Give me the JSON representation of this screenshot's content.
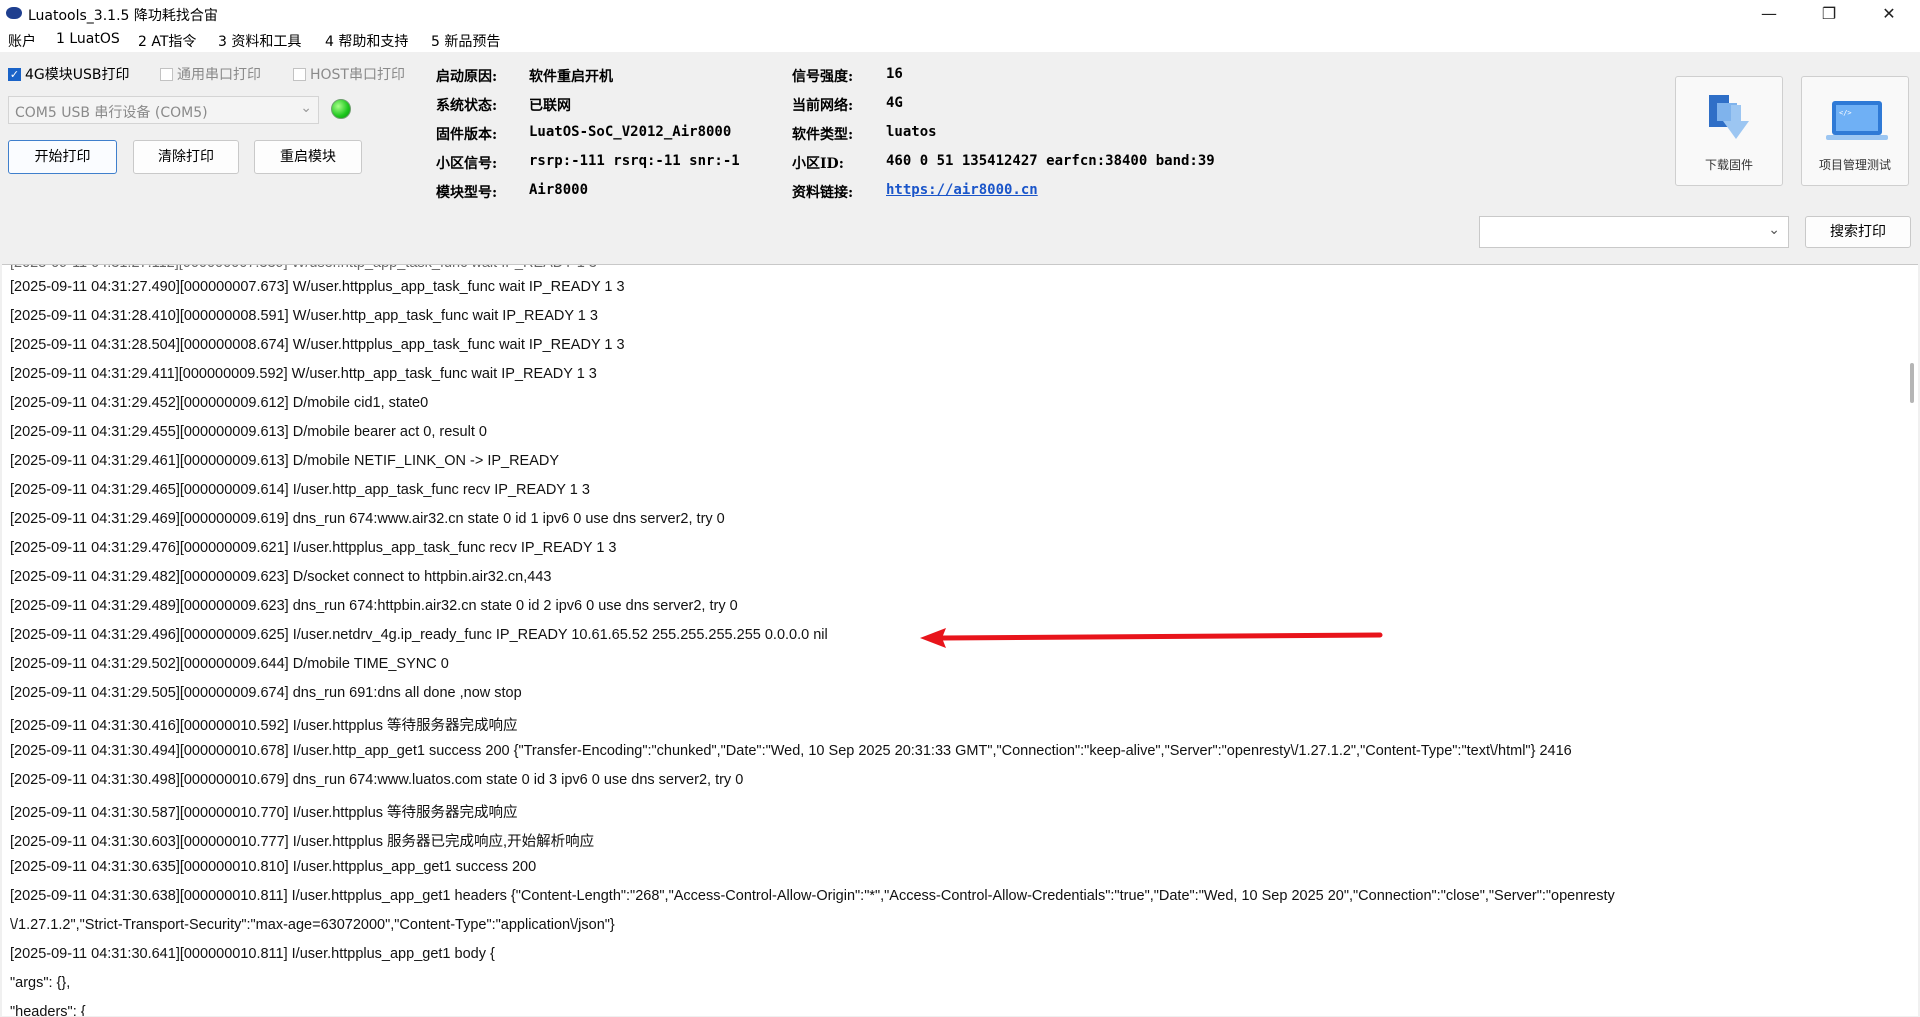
{
  "window": {
    "title": "Luatools_3.1.5 降功耗找合宙",
    "minimize": "—",
    "restore": "❐",
    "close": "✕"
  },
  "menu": [
    "账户",
    "1 LuatOS",
    "2 AT指令",
    "3 资料和工具",
    "4 帮助和支持",
    "5 新品预告"
  ],
  "options": {
    "usb_print": {
      "label": "4G模块USB打印",
      "checked": true
    },
    "serial_print": {
      "label": "通用串口打印",
      "checked": false
    },
    "host_print": {
      "label": "HOST串口打印",
      "checked": false
    }
  },
  "port_select": {
    "value": "COM5 USB 串行设备 (COM5)"
  },
  "buttons": {
    "start_print": "开始打印",
    "clear_print": "清除打印",
    "restart_module": "重启模块"
  },
  "device_info": {
    "boot_reason_label": "启动原因:",
    "boot_reason": "软件重启开机",
    "system_state_label": "系统状态:",
    "system_state": "已联网",
    "firmware_label": "固件版本:",
    "firmware": "LuatOS-SoC_V2012_Air8000",
    "cell_signal_label": "小区信号:",
    "cell_signal": "rsrp:-111 rsrq:-11 snr:-1",
    "module_model_label": "模块型号:",
    "module_model": "Air8000",
    "signal_strength_label": "信号强度:",
    "signal_strength": "16",
    "network_label": "当前网络:",
    "network": "4G",
    "software_type_label": "软件类型:",
    "software_type": "luatos",
    "cell_id_label": "小区ID:",
    "cell_id": "460 0 51 135412427 earfcn:38400 band:39",
    "docs_link_label": "资料链接:",
    "docs_link": "https://air8000.cn"
  },
  "tools": {
    "download_firmware": "下载固件",
    "project_test": "项目管理测试"
  },
  "search": {
    "value": "",
    "button": "搜索打印"
  },
  "log": [
    "[2025-09-11 04:31:27.490][000000007.673] W/user.httpplus_app_task_func wait IP_READY 1 3",
    "[2025-09-11 04:31:28.410][000000008.591] W/user.http_app_task_func wait IP_READY 1 3",
    "[2025-09-11 04:31:28.504][000000008.674] W/user.httpplus_app_task_func wait IP_READY 1 3",
    "[2025-09-11 04:31:29.411][000000009.592] W/user.http_app_task_func wait IP_READY 1 3",
    "[2025-09-11 04:31:29.452][000000009.612] D/mobile cid1, state0",
    "[2025-09-11 04:31:29.455][000000009.613] D/mobile bearer act 0, result 0",
    "[2025-09-11 04:31:29.461][000000009.613] D/mobile NETIF_LINK_ON -> IP_READY",
    "[2025-09-11 04:31:29.465][000000009.614] I/user.http_app_task_func recv IP_READY 1 3",
    "[2025-09-11 04:31:29.469][000000009.619] dns_run 674:www.air32.cn state 0 id 1 ipv6 0 use dns server2, try 0",
    "[2025-09-11 04:31:29.476][000000009.621] I/user.httpplus_app_task_func recv IP_READY 1 3",
    "[2025-09-11 04:31:29.482][000000009.623] D/socket connect to httpbin.air32.cn,443",
    "[2025-09-11 04:31:29.489][000000009.623] dns_run 674:httpbin.air32.cn state 0 id 2 ipv6 0 use dns server2, try 0",
    "[2025-09-11 04:31:29.496][000000009.625] I/user.netdrv_4g.ip_ready_func IP_READY 10.61.65.52 255.255.255.255 0.0.0.0 nil",
    "[2025-09-11 04:31:29.502][000000009.644] D/mobile TIME_SYNC 0",
    "[2025-09-11 04:31:29.505][000000009.674] dns_run 691:dns all done ,now stop",
    "[2025-09-11 04:31:30.416][000000010.592] I/user.httpplus 等待服务器完成响应",
    "[2025-09-11 04:31:30.494][000000010.678] I/user.http_app_get1 success 200 {\"Transfer-Encoding\":\"chunked\",\"Date\":\"Wed, 10 Sep 2025 20:31:33 GMT\",\"Connection\":\"keep-alive\",\"Server\":\"openresty\\/1.27.1.2\",\"Content-Type\":\"text\\/html\"} 2416",
    "[2025-09-11 04:31:30.498][000000010.679] dns_run 674:www.luatos.com state 0 id 3 ipv6 0 use dns server2, try 0",
    "[2025-09-11 04:31:30.587][000000010.770] I/user.httpplus 等待服务器完成响应",
    "[2025-09-11 04:31:30.603][000000010.777] I/user.httpplus 服务器已完成响应,开始解析响应",
    "[2025-09-11 04:31:30.635][000000010.810] I/user.httpplus_app_get1 success 200",
    "[2025-09-11 04:31:30.638][000000010.811] I/user.httpplus_app_get1 headers {\"Content-Length\":\"268\",\"Access-Control-Allow-Origin\":\"*\",\"Access-Control-Allow-Credentials\":\"true\",\"Date\":\"Wed, 10 Sep 2025 20\",\"Connection\":\"close\",\"Server\":\"openresty",
    "\\/1.27.1.2\",\"Strict-Transport-Security\":\"max-age=63072000\",\"Content-Type\":\"application\\/json\"}",
    "[2025-09-11 04:31:30.641][000000010.811] I/user.httpplus_app_get1 body {",
    "  \"args\": {},",
    "  \"headers\": {"
  ],
  "colors": {
    "annotation_arrow": "#e8141b",
    "status_led": "#1cc61c",
    "link": "#1a55c9"
  }
}
